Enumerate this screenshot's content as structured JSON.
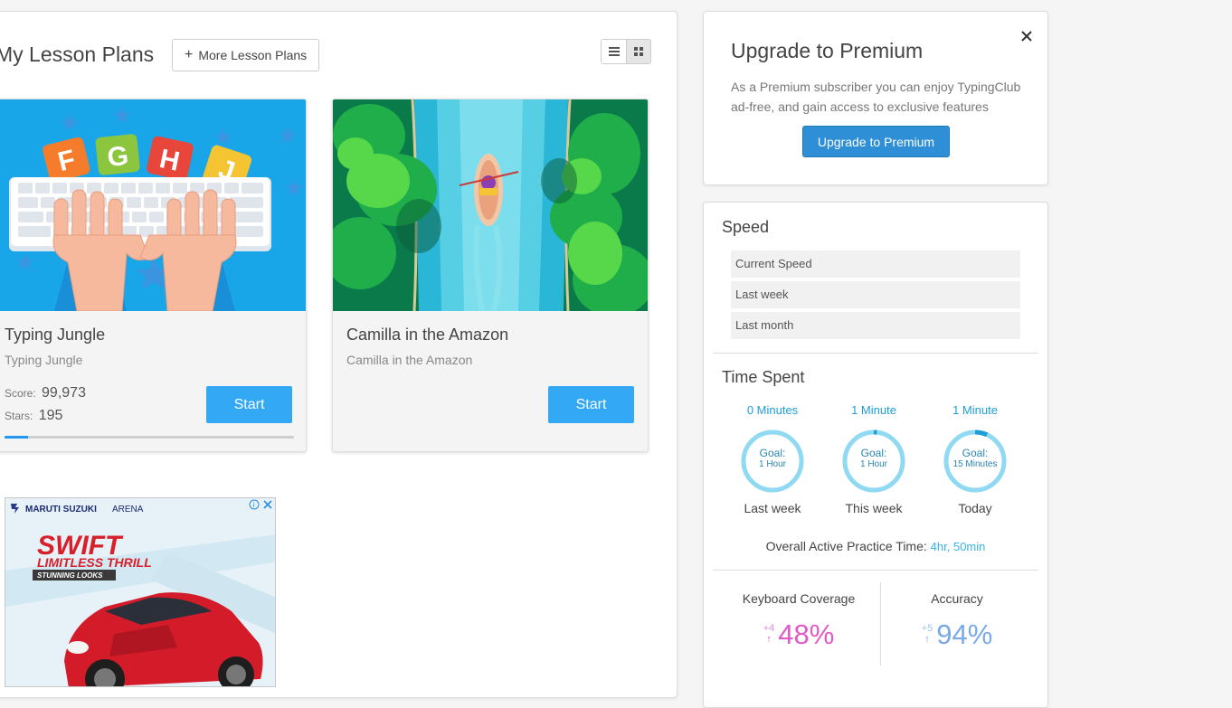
{
  "main": {
    "title": "My Lesson Plans",
    "more_button": "More Lesson Plans",
    "view_modes": [
      "list-view-icon",
      "grid-view-icon"
    ],
    "active_view": "grid"
  },
  "cards": [
    {
      "title": "Typing Jungle",
      "subtitle": "Typing Jungle",
      "score_label": "Score:",
      "score": "99,973",
      "stars_label": "Stars:",
      "stars": "195",
      "progress": 0.08,
      "start": "Start",
      "art_letters": [
        "F",
        "G",
        "H",
        "J"
      ]
    },
    {
      "title": "Camilla in the Amazon",
      "subtitle": "Camilla in the Amazon",
      "start": "Start"
    }
  ],
  "ad": {
    "brand": "MARUTI SUZUKI",
    "arena": "ARENA",
    "headline": "SWIFT",
    "tagline": "LIMITLESS THRILL",
    "subline": "STUNNING LOOKS"
  },
  "premium": {
    "title": "Upgrade to Premium",
    "description": "As a Premium subscriber you can enjoy TypingClub ad-free, and gain access to exclusive features",
    "button": "Upgrade to Premium"
  },
  "speed": {
    "title": "Speed",
    "rows": [
      "Current Speed",
      "Last week",
      "Last month"
    ]
  },
  "time_spent": {
    "title": "Time Spent",
    "rings": [
      {
        "value": "0 Minutes",
        "goal_label": "Goal:",
        "goal": "1 Hour",
        "period": "Last week",
        "fraction": 0.0
      },
      {
        "value": "1 Minute",
        "goal_label": "Goal:",
        "goal": "1 Hour",
        "period": "This week",
        "fraction": 0.017
      },
      {
        "value": "1 Minute",
        "goal_label": "Goal:",
        "goal": "15 Minutes",
        "period": "Today",
        "fraction": 0.067
      }
    ],
    "overall_label": "Overall Active Practice Time:",
    "overall_value": "4hr, 50min"
  },
  "metrics": [
    {
      "label": "Keyboard Coverage",
      "delta": "+4",
      "value": "48%",
      "color": "#e05ac8"
    },
    {
      "label": "Accuracy",
      "delta": "+5",
      "value": "94%",
      "color": "#7aa9e8"
    }
  ],
  "colors": {
    "accent": "#33a9f5",
    "ring": "#8fd9f3",
    "ring_progress": "#1e9ed6",
    "premium_button": "#2f8fd6"
  }
}
